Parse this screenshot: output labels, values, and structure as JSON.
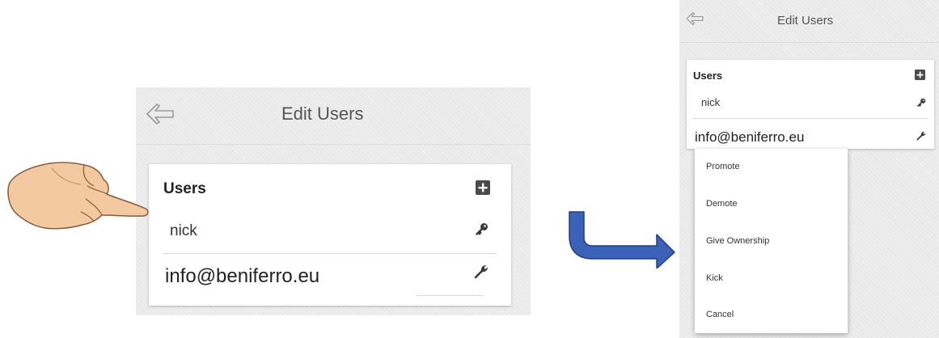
{
  "left_screen": {
    "app_bar": {
      "title": "Edit Users",
      "back_icon": "arrow-left-icon"
    },
    "card": {
      "heading": "Users",
      "add_icon": "plus-square-icon",
      "rows": [
        {
          "label": "nick",
          "icon": "key-icon"
        },
        {
          "label": "info@beniferro.eu",
          "icon": "wrench-icon"
        }
      ]
    }
  },
  "right_screen": {
    "app_bar": {
      "title": "Edit Users",
      "back_icon": "arrow-left-icon"
    },
    "card": {
      "heading": "Users",
      "add_icon": "plus-square-icon",
      "rows": [
        {
          "label": "nick",
          "icon": "key-icon"
        },
        {
          "label": "info@beniferro.eu",
          "icon": "wrench-icon"
        }
      ]
    },
    "context_menu": {
      "items": [
        "Promote",
        "Demote",
        "Give Ownership",
        "Kick",
        "Cancel"
      ]
    }
  },
  "annotations": {
    "hand": "pointing-hand-icon",
    "arrow": "curved-arrow-right-icon",
    "colors": {
      "arrow_fill": "#3b62b8",
      "arrow_stroke": "#1f3f80",
      "skin": "#f2c9a0"
    }
  }
}
